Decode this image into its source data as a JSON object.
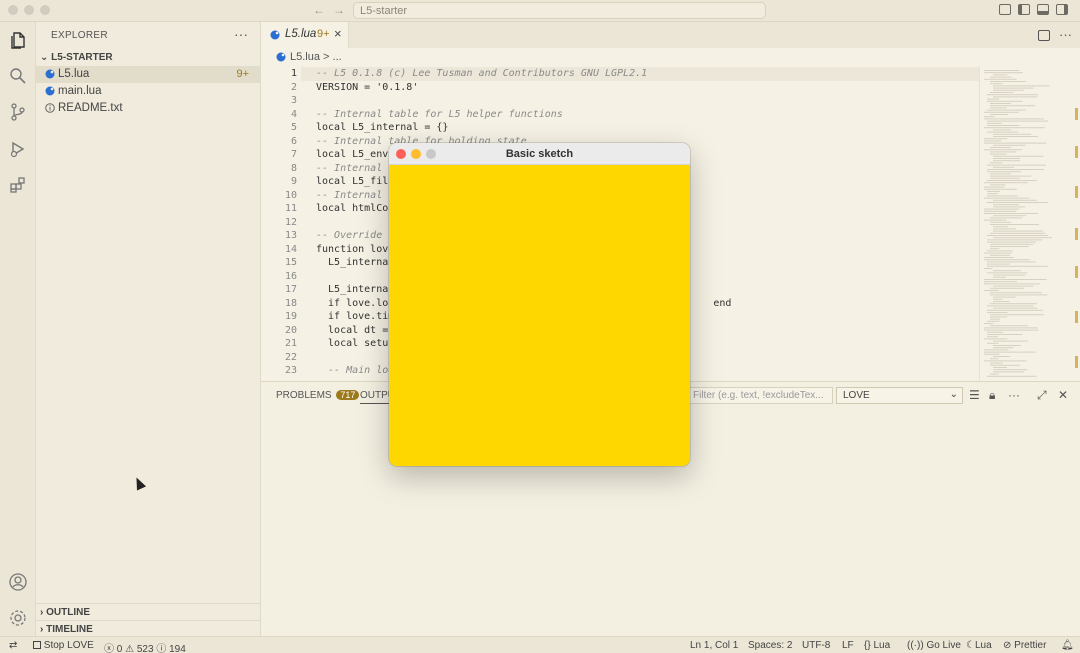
{
  "window": {
    "title": "L5-starter",
    "nav_back": "←",
    "nav_forward": "→"
  },
  "sidebar": {
    "title": "EXPLORER",
    "more": "···",
    "section": "L5-STARTER",
    "files": [
      {
        "name": "L5.lua",
        "badge": "9+",
        "icon": "lua-icon"
      },
      {
        "name": "main.lua",
        "badge": "",
        "icon": "lua-icon"
      },
      {
        "name": "README.txt",
        "badge": "",
        "icon": "info-icon"
      }
    ],
    "outline": "OUTLINE",
    "timeline": "TIMELINE"
  },
  "tabs": [
    {
      "label": "L5.lua",
      "badge": "9+",
      "close": "×"
    }
  ],
  "breadcrumbs": {
    "file": "L5.lua",
    "sep": "> ..."
  },
  "code": {
    "lines": [
      {
        "n": "1",
        "text": "-- L5 0.1.8 (c) Lee Tusman and Contributors GNU LGPL2.1",
        "comment": true
      },
      {
        "n": "2",
        "text": "VERSION = '0.1.8'",
        "comment": false
      },
      {
        "n": "3",
        "text": "",
        "comment": false
      },
      {
        "n": "4",
        "text": "-- Internal table for L5 helper functions",
        "comment": true
      },
      {
        "n": "5",
        "text": "local L5_internal = {}",
        "comment": false
      },
      {
        "n": "6",
        "text": "-- Internal table for holding state",
        "comment": true
      },
      {
        "n": "7",
        "text": "local L5_env = ",
        "comment": false
      },
      {
        "n": "8",
        "text": "-- Internal ta",
        "comment": true
      },
      {
        "n": "9",
        "text": "local L5_filte",
        "comment": false
      },
      {
        "n": "10",
        "text": "-- Internal ta",
        "comment": true
      },
      {
        "n": "11",
        "text": "local htmlColo",
        "comment": false
      },
      {
        "n": "12",
        "text": "",
        "comment": false
      },
      {
        "n": "13",
        "text": "-- Override lo",
        "comment": true
      },
      {
        "n": "14",
        "text": "function love.",
        "comment": false
      },
      {
        "n": "15",
        "text": "  L5_internal.",
        "comment": false
      },
      {
        "n": "16",
        "text": "",
        "comment": false
      },
      {
        "n": "17",
        "text": "  L5_internal.",
        "comment": false
      },
      {
        "n": "18",
        "text": "  if love.load                                                    end",
        "comment": false
      },
      {
        "n": "19",
        "text": "  if love.time",
        "comment": false
      },
      {
        "n": "20",
        "text": "  local dt = 0",
        "comment": false
      },
      {
        "n": "21",
        "text": "  local setupC",
        "comment": false
      },
      {
        "n": "22",
        "text": "",
        "comment": false
      },
      {
        "n": "23",
        "text": "  -- Main loop",
        "comment": true
      }
    ]
  },
  "panel": {
    "problems_label": "PROBLEMS",
    "problems_count": "717",
    "output_label": "OUTPUT",
    "filter_placeholder": "Filter (e.g. text, !excludeTex...",
    "channel": "LOVE"
  },
  "love_window": {
    "title": "Basic sketch",
    "background": "#ffd700"
  },
  "status": {
    "remote": "⇄",
    "stop": "Stop LOVE",
    "errors": "0",
    "warnings": "523",
    "infos": "194",
    "position": "Ln 1, Col 1",
    "spaces": "Spaces: 2",
    "encoding": "UTF-8",
    "eol": "LF",
    "language": "Lua",
    "golive": "Go Live",
    "lua2": "Lua",
    "prettier": "Prettier"
  },
  "colors": {
    "accent_badge": "#9c7a1b",
    "editor_bg": "#f5f1e4"
  }
}
